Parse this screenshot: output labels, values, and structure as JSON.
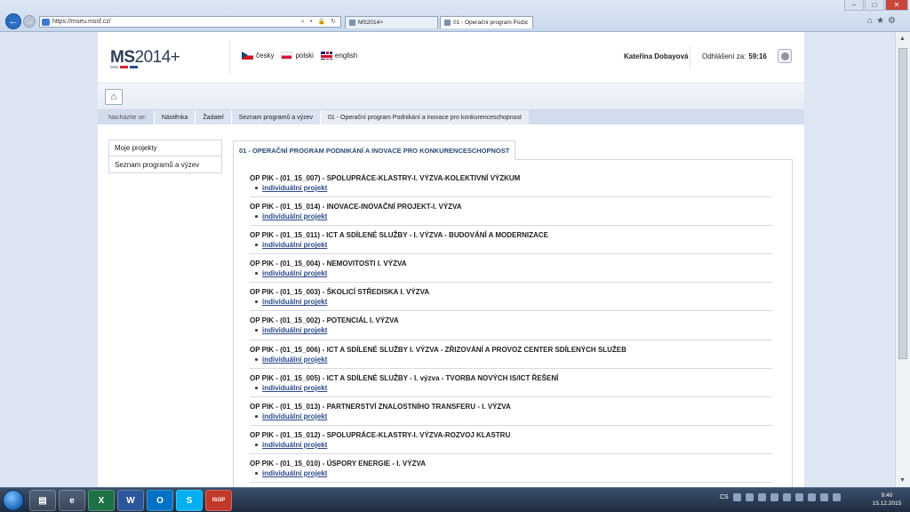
{
  "browser": {
    "url": "https://mseu.mssf.cz/",
    "tabs": [
      {
        "label": "MS2014+"
      },
      {
        "label": "01 - Operační program Pod..."
      }
    ]
  },
  "header": {
    "logo_main": "MS",
    "logo_rest": "2014+",
    "languages": [
      {
        "label": "česky",
        "flag": "cz"
      },
      {
        "label": "polski",
        "flag": "pl"
      },
      {
        "label": "english",
        "flag": "en"
      }
    ],
    "user_name": "Kateřina Dobayová",
    "logout_label": "Odhlášení za:",
    "logout_timer": "59:16"
  },
  "breadcrumb": {
    "label": "Nacházíte se:",
    "items": [
      "Nástěnka",
      "Žadatel",
      "Seznam programů a výzev",
      "01 - Operační program Podnikání a inovace pro konkurenceschopnost"
    ]
  },
  "side_menu": {
    "items": [
      "Moje projekty",
      "Seznam programů a výzev"
    ]
  },
  "panel": {
    "title": "01 - OPERAČNÍ PROGRAM PODNIKÁNÍ A INOVACE PRO KONKURENCESCHOPNOST",
    "programs": [
      {
        "title": "OP PIK - (01_15_007) - SPOLUPRÁCE-KLASTRY-I. VÝZVA-KOLEKTIVNÍ VÝZKUM",
        "sub": "individuální projekt"
      },
      {
        "title": "OP PIK - (01_15_014) - INOVACE-INOVAČNÍ PROJEKT-I. VÝZVA",
        "sub": "individuální projekt"
      },
      {
        "title": "OP PIK - (01_15_011) - ICT A SDÍLENÉ SLUŽBY - I. VÝZVA - BUDOVÁNÍ A MODERNIZACE",
        "sub": "individuální projekt"
      },
      {
        "title": "OP PIK - (01_15_004) - NEMOVITOSTI I. VÝZVA",
        "sub": "individuální projekt"
      },
      {
        "title": "OP PIK - (01_15_003) - ŠKOLICÍ STŘEDISKA I. VÝZVA",
        "sub": "individuální projekt"
      },
      {
        "title": "OP PIK - (01_15_002) - POTENCIÁL I. VÝZVA",
        "sub": "individuální projekt"
      },
      {
        "title": "OP PIK - (01_15_006) - ICT A SDÍLENÉ SLUŽBY I. VÝZVA - ZŘIZOVÁNÍ A PROVOZ CENTER SDÍLENÝCH SLUŽEB",
        "sub": "individuální projekt"
      },
      {
        "title": "OP PIK - (01_15_005) - ICT A SDÍLENÉ SLUŽBY - I. výzva - TVORBA NOVÝCH IS/ICT ŘEŠENÍ",
        "sub": "individuální projekt"
      },
      {
        "title": "OP PIK - (01_15_013) - PARTNERSTVÍ ZNALOSTNÍHO TRANSFERU - I. VÝZVA",
        "sub": "individuální projekt"
      },
      {
        "title": "OP PIK - (01_15_012) - SPOLUPRÁCE-KLASTRY-I. VÝZVA-ROZVOJ KLASTRU",
        "sub": "individuální projekt"
      },
      {
        "title": "OP PIK - (01_15_010) - ÚSPORY ENERGIE - I. VÝZVA",
        "sub": "individuální projekt"
      }
    ]
  },
  "taskbar": {
    "apps": [
      "explorer",
      "ie",
      "X",
      "W",
      "O",
      "S",
      "ISOP"
    ],
    "lang": "CS",
    "time": "9:40",
    "date": "15.12.2015"
  },
  "colors": {
    "accent": "#2b4a8a",
    "logo_bar_1": "#b8bfca",
    "logo_bar_2": "#d9232e",
    "logo_bar_3": "#2b4a8a"
  }
}
